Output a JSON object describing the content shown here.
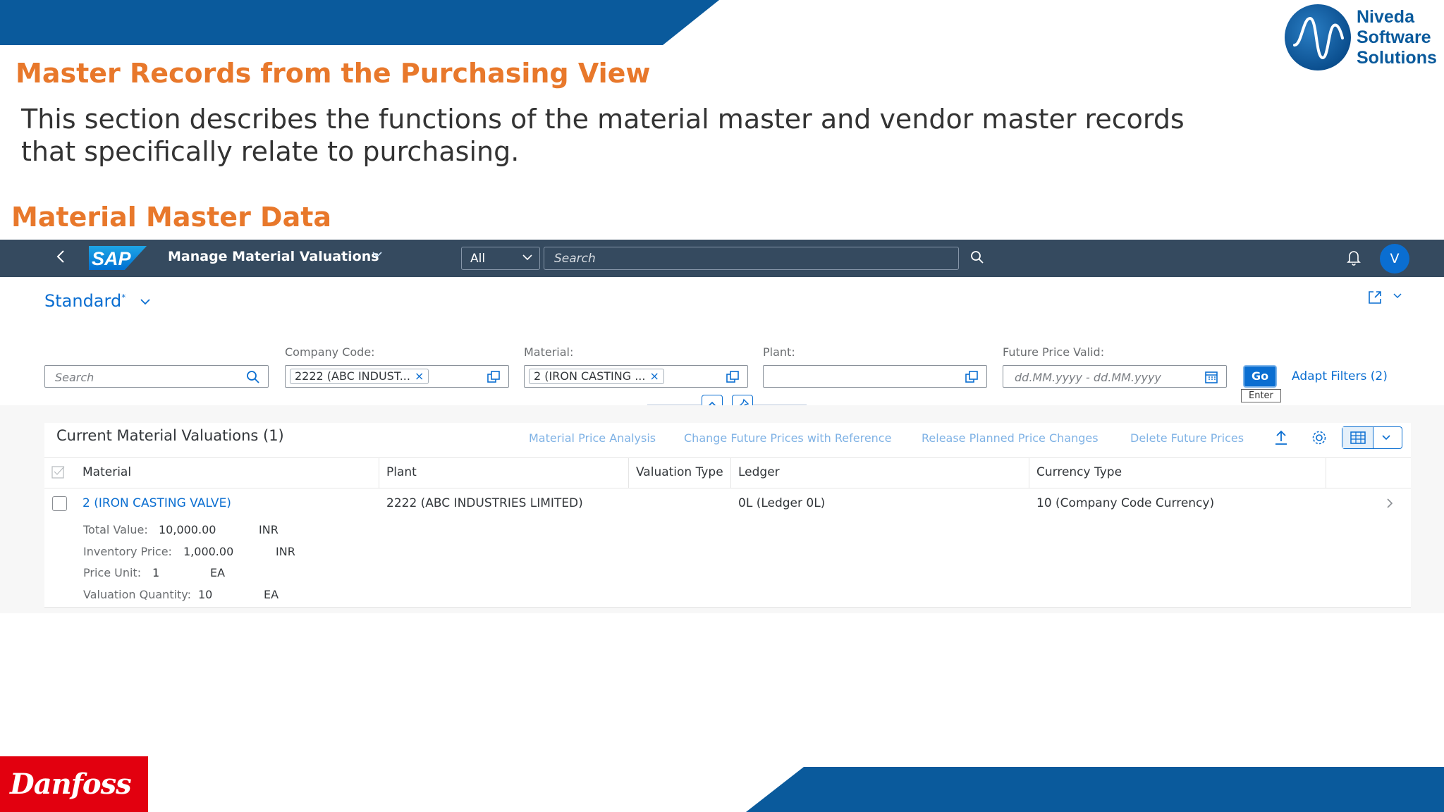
{
  "slide": {
    "title": "Master Records from the Purchasing View",
    "description": "This section describes the functions of the material master and vendor master records that specifically relate to purchasing.",
    "section_title": "Material Master Data",
    "brand_lines": [
      "Niveda",
      "Software",
      "Solutions"
    ],
    "footer_logo": "Danfoss"
  },
  "shell": {
    "logo": "SAP",
    "app_title": "Manage Material Valuations",
    "scope_value": "All",
    "search_placeholder": "Search",
    "user_initial": "V"
  },
  "filterbar": {
    "variant": "Standard",
    "variant_modified": "*",
    "search_placeholder": "Search",
    "company_code_label": "Company Code:",
    "company_code_token": "2222 (ABC INDUST...",
    "material_label": "Material:",
    "material_token": "2 (IRON CASTING ...",
    "plant_label": "Plant:",
    "future_price_label": "Future Price Valid:",
    "date_placeholder": "dd.MM.yyyy - dd.MM.yyyy",
    "go_label": "Go",
    "go_tooltip": "Enter",
    "adapt_filters": "Adapt Filters (2)"
  },
  "table": {
    "title": "Current Material Valuations (1)",
    "actions": [
      "Material Price Analysis",
      "Change Future Prices with Reference",
      "Release Planned Price Changes",
      "Delete Future Prices"
    ],
    "columns": [
      "Material",
      "Plant",
      "Valuation Type",
      "Ledger",
      "Currency Type"
    ],
    "row": {
      "material": "2 (IRON CASTING VALVE)",
      "plant": "2222 (ABC INDUSTRIES  LIMITED)",
      "valuation_type": "",
      "ledger": "0L (Ledger 0L)",
      "currency_type": "10 (Company Code Currency)",
      "attributes": [
        {
          "label": "Total Value:",
          "value": "10,000.00",
          "unit": "INR"
        },
        {
          "label": "Inventory Price:",
          "value": "1,000.00",
          "unit": "INR"
        },
        {
          "label": "Price Unit:",
          "value": "1",
          "unit": "EA"
        },
        {
          "label": "Valuation Quantity:",
          "value": "10",
          "unit": "EA"
        }
      ]
    }
  },
  "colors": {
    "accent_orange": "#e8782b",
    "brand_blue": "#0a5a9c",
    "shell_bg": "#354a5f",
    "sap_link": "#0a6ed1",
    "danfoss_red": "#e2000f"
  }
}
